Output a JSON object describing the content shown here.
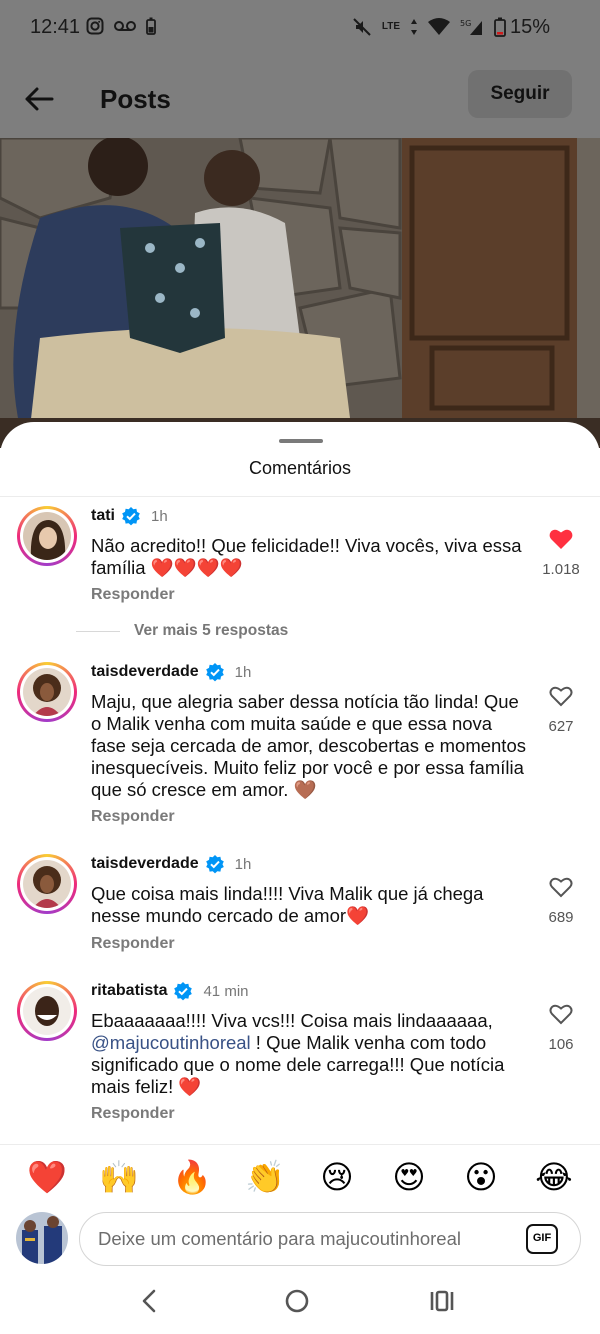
{
  "status_bar": {
    "time": "12:41",
    "network": "LTE",
    "battery": "15%"
  },
  "header": {
    "title": "Posts",
    "follow_label": "Seguir"
  },
  "sheet": {
    "title": "Comentários"
  },
  "comments": [
    {
      "username": "tati",
      "verified": true,
      "time": "1h",
      "text": "Não acredito!! Que felicidade!! Viva vocês, viva essa família ❤️❤️❤️❤️",
      "reply_label": "Responder",
      "likes": "1.018",
      "liked": true
    },
    {
      "username": "taisdeverdade",
      "verified": true,
      "time": "1h",
      "text": "Maju, que alegria saber dessa notícia tão linda! Que o Malik venha com muita saúde e que essa nova fase seja cercada de amor, descobertas e momentos inesquecíveis. Muito feliz por você e por essa família que só cresce em amor. 🤎",
      "reply_label": "Responder",
      "likes": "627",
      "liked": false
    },
    {
      "username": "taisdeverdade",
      "verified": true,
      "time": "1h",
      "text": "Que coisa mais linda!!!! Viva Malik que já chega nesse mundo cercado de amor❤️",
      "reply_label": "Responder",
      "likes": "689",
      "liked": false
    },
    {
      "username": "ritabatista",
      "verified": true,
      "time": "41 min",
      "text_before": "Ebaaaaaaa!!!! Viva vcs!!! Coisa mais lindaaaaaa, ",
      "mention": "@majucoutinhoreal",
      "text_after": " ! Que Malik venha com todo significado que o nome dele carrega!!! Que notícia mais feliz! ❤️",
      "reply_label": "Responder",
      "likes": "106",
      "liked": false
    }
  ],
  "more_replies_label": "Ver mais 5 respostas",
  "emoji_bar": [
    "❤️",
    "🙌",
    "🔥",
    "👏",
    "😢",
    "😍",
    "😮",
    "😂"
  ],
  "comment_input": {
    "placeholder": "Deixe um comentário para majucoutinhoreal",
    "gif_label": "GIF"
  },
  "colors": {
    "like_red": "#ff3040",
    "verified_blue": "#0095f6",
    "mention_blue": "#385185"
  }
}
